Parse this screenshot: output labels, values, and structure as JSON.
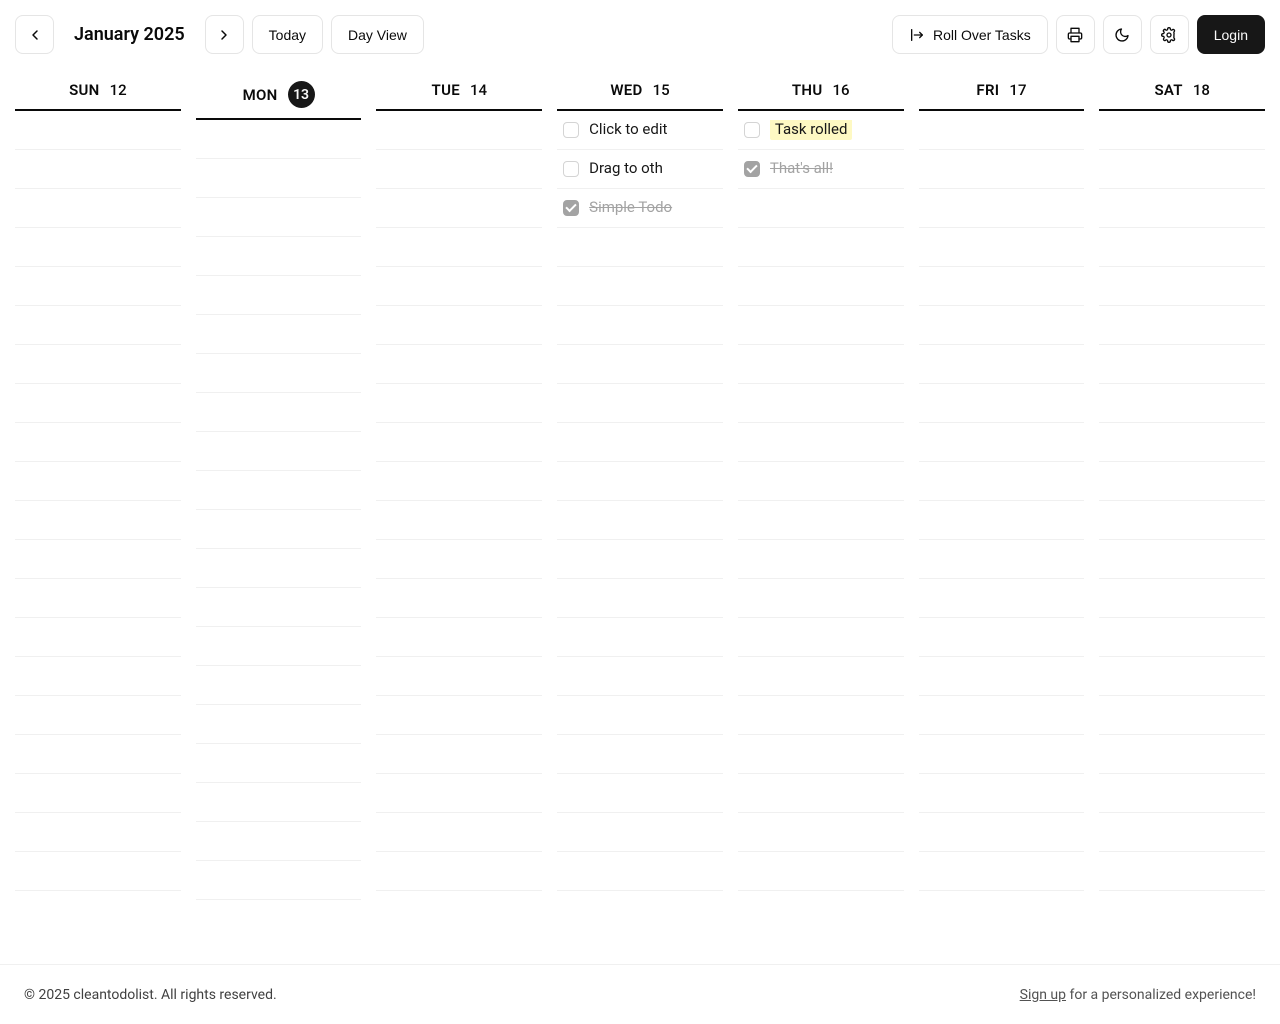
{
  "toolbar": {
    "month_label": "January 2025",
    "today_label": "Today",
    "view_label": "Day View",
    "rollover_label": "Roll Over Tasks",
    "login_label": "Login"
  },
  "days": [
    {
      "dow": "SUN",
      "num": "12",
      "today": false,
      "tasks": []
    },
    {
      "dow": "MON",
      "num": "13",
      "today": true,
      "tasks": []
    },
    {
      "dow": "TUE",
      "num": "14",
      "today": false,
      "tasks": []
    },
    {
      "dow": "WED",
      "num": "15",
      "today": false,
      "tasks": [
        {
          "text": "Click to edit",
          "done": false,
          "highlight": false
        },
        {
          "text": "Drag to oth",
          "done": false,
          "highlight": false
        },
        {
          "text": "Simple Todo",
          "done": true,
          "highlight": false
        }
      ]
    },
    {
      "dow": "THU",
      "num": "16",
      "today": false,
      "tasks": [
        {
          "text": "Task rolled",
          "done": false,
          "highlight": true
        },
        {
          "text": "That's all!",
          "done": true,
          "highlight": false
        }
      ]
    },
    {
      "dow": "FRI",
      "num": "17",
      "today": false,
      "tasks": []
    },
    {
      "dow": "SAT",
      "num": "18",
      "today": false,
      "tasks": []
    }
  ],
  "blank_rows_per_day": 20,
  "footer": {
    "copyright": "© 2025 cleantodolist. All rights reserved.",
    "signup_prefix": "Sign up",
    "signup_suffix": " for a personalized experience!"
  }
}
